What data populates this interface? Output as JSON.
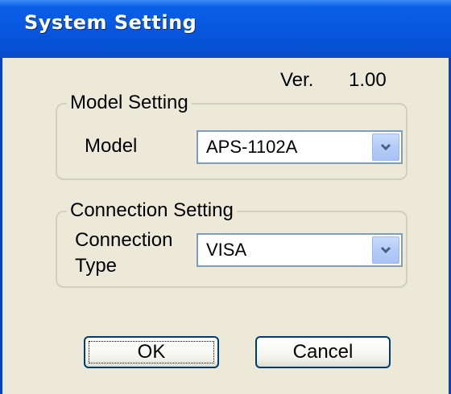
{
  "window": {
    "title": "System Setting"
  },
  "version": {
    "label": "Ver.",
    "value": "1.00"
  },
  "model_group": {
    "legend": "Model Setting",
    "field_label": "Model",
    "selected": "APS-1102A"
  },
  "connection_group": {
    "legend": "Connection Setting",
    "field_label_line1": "Connection",
    "field_label_line2": "Type",
    "selected": "VISA"
  },
  "buttons": {
    "ok": "OK",
    "cancel": "Cancel"
  },
  "colors": {
    "titlebar": "#0a58e0",
    "dialog_bg": "#ece9d8",
    "button_border": "#003c74"
  }
}
